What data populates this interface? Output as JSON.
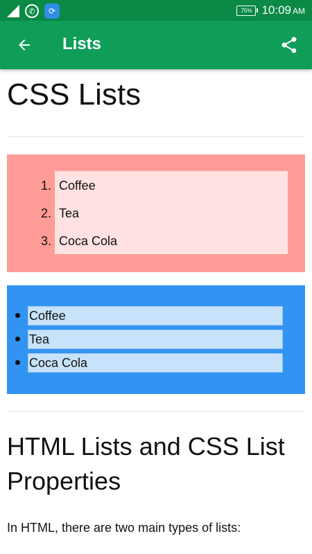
{
  "status_bar": {
    "time": "10:09",
    "ampm": "AM",
    "battery": "75%"
  },
  "app_bar": {
    "title": "Lists"
  },
  "page": {
    "title": "CSS Lists",
    "ordered_list": {
      "items": [
        {
          "num": "1.",
          "label": "Coffee"
        },
        {
          "num": "2.",
          "label": "Tea"
        },
        {
          "num": "3.",
          "label": "Coca Cola"
        }
      ]
    },
    "unordered_list": {
      "items": [
        "Coffee",
        "Tea",
        "Coca Cola"
      ]
    },
    "section_heading": "HTML Lists and CSS List Properties",
    "paragraph": "In HTML, there are two main types of lists:"
  }
}
